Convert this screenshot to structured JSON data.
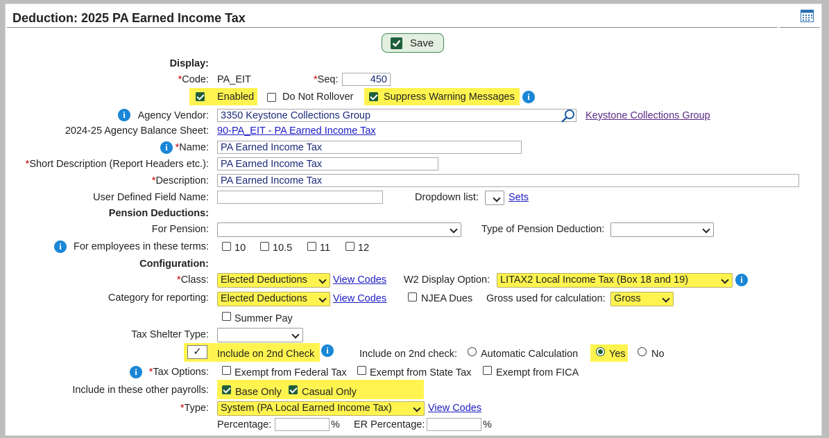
{
  "header": {
    "title": "Deduction: 2025 PA Earned Income Tax",
    "icon": "calendar-icon"
  },
  "toolbar": {
    "save_label": "Save"
  },
  "display": {
    "section_label": "Display:",
    "code_label": "Code:",
    "code_value": "PA_EIT",
    "seq_label": "Seq:",
    "seq_value": "450",
    "enabled_label": "Enabled",
    "enabled_checked": true,
    "do_not_rollover_label": "Do Not Rollover",
    "do_not_rollover_checked": false,
    "suppress_label": "Suppress Warning Messages",
    "suppress_checked": true,
    "agency_vendor_label": "Agency Vendor:",
    "agency_vendor_value": "3350 Keystone Collections Group",
    "agency_vendor_link": "Keystone Collections Group",
    "balance_sheet_label": "2024-25 Agency Balance Sheet:",
    "balance_sheet_link": "90-PA_EIT - PA Earned Income Tax",
    "name_label": "Name:",
    "name_value": "PA Earned Income Tax",
    "short_desc_label": "Short Description (Report Headers etc.):",
    "short_desc_value": "PA Earned Income Tax",
    "description_label": "Description:",
    "description_value": "PA Earned Income Tax",
    "udf_label": "User Defined Field Name:",
    "udf_value": "",
    "dropdown_list_label": "Dropdown list:",
    "sets_link": "Sets"
  },
  "pension": {
    "section_label": "Pension Deductions:",
    "for_pension_label": "For Pension:",
    "for_pension_value": "",
    "type_label": "Type of Pension Deduction:",
    "type_value": "",
    "terms_label": "For employees in these terms:",
    "terms": [
      {
        "label": "10",
        "checked": false
      },
      {
        "label": "10.5",
        "checked": false
      },
      {
        "label": "11",
        "checked": false
      },
      {
        "label": "12",
        "checked": false
      }
    ]
  },
  "config": {
    "section_label": "Configuration:",
    "class_label": "Class:",
    "class_value": "Elected Deductions",
    "class_link": "View Codes",
    "w2_label": "W2 Display Option:",
    "w2_value": "LITAX2 Local Income Tax (Box 18 and 19)",
    "category_label": "Category for reporting:",
    "category_value": "Elected Deductions",
    "category_link": "View Codes",
    "njea_label": "NJEA Dues",
    "njea_checked": false,
    "gross_label": "Gross used for calculation:",
    "gross_value": "Gross",
    "summer_pay_label": "Summer Pay",
    "summer_pay_checked": false,
    "tax_shelter_label": "Tax Shelter Type:",
    "tax_shelter_value": "",
    "include_2nd_label": "Include on 2nd Check",
    "include_2nd_mark": "✓",
    "include_2nd_check_label": "Include on 2nd check:",
    "radio_auto_label": "Automatic Calculation",
    "radio_yes_label": "Yes",
    "radio_no_label": "No",
    "radio_selected": "Yes",
    "tax_options_label": "Tax Options:",
    "exempt_federal_label": "Exempt from Federal Tax",
    "exempt_state_label": "Exempt from State Tax",
    "exempt_fica_label": "Exempt from FICA",
    "other_payrolls_label": "Include in these other payrolls:",
    "base_only_label": "Base Only",
    "casual_only_label": "Casual Only",
    "type_label": "Type:",
    "type_value": "System (PA Local Earned Income Tax)",
    "type_link": "View Codes",
    "percentage_label": "Percentage:",
    "percentage_value": "",
    "er_percentage_label": "ER Percentage:",
    "er_percentage_value": "",
    "percent_sign": "%"
  },
  "colors": {
    "highlight": "#fff44f",
    "link": "#1b1bc4",
    "accent_green": "#1f5e3b",
    "info_blue": "#1a86d6"
  }
}
